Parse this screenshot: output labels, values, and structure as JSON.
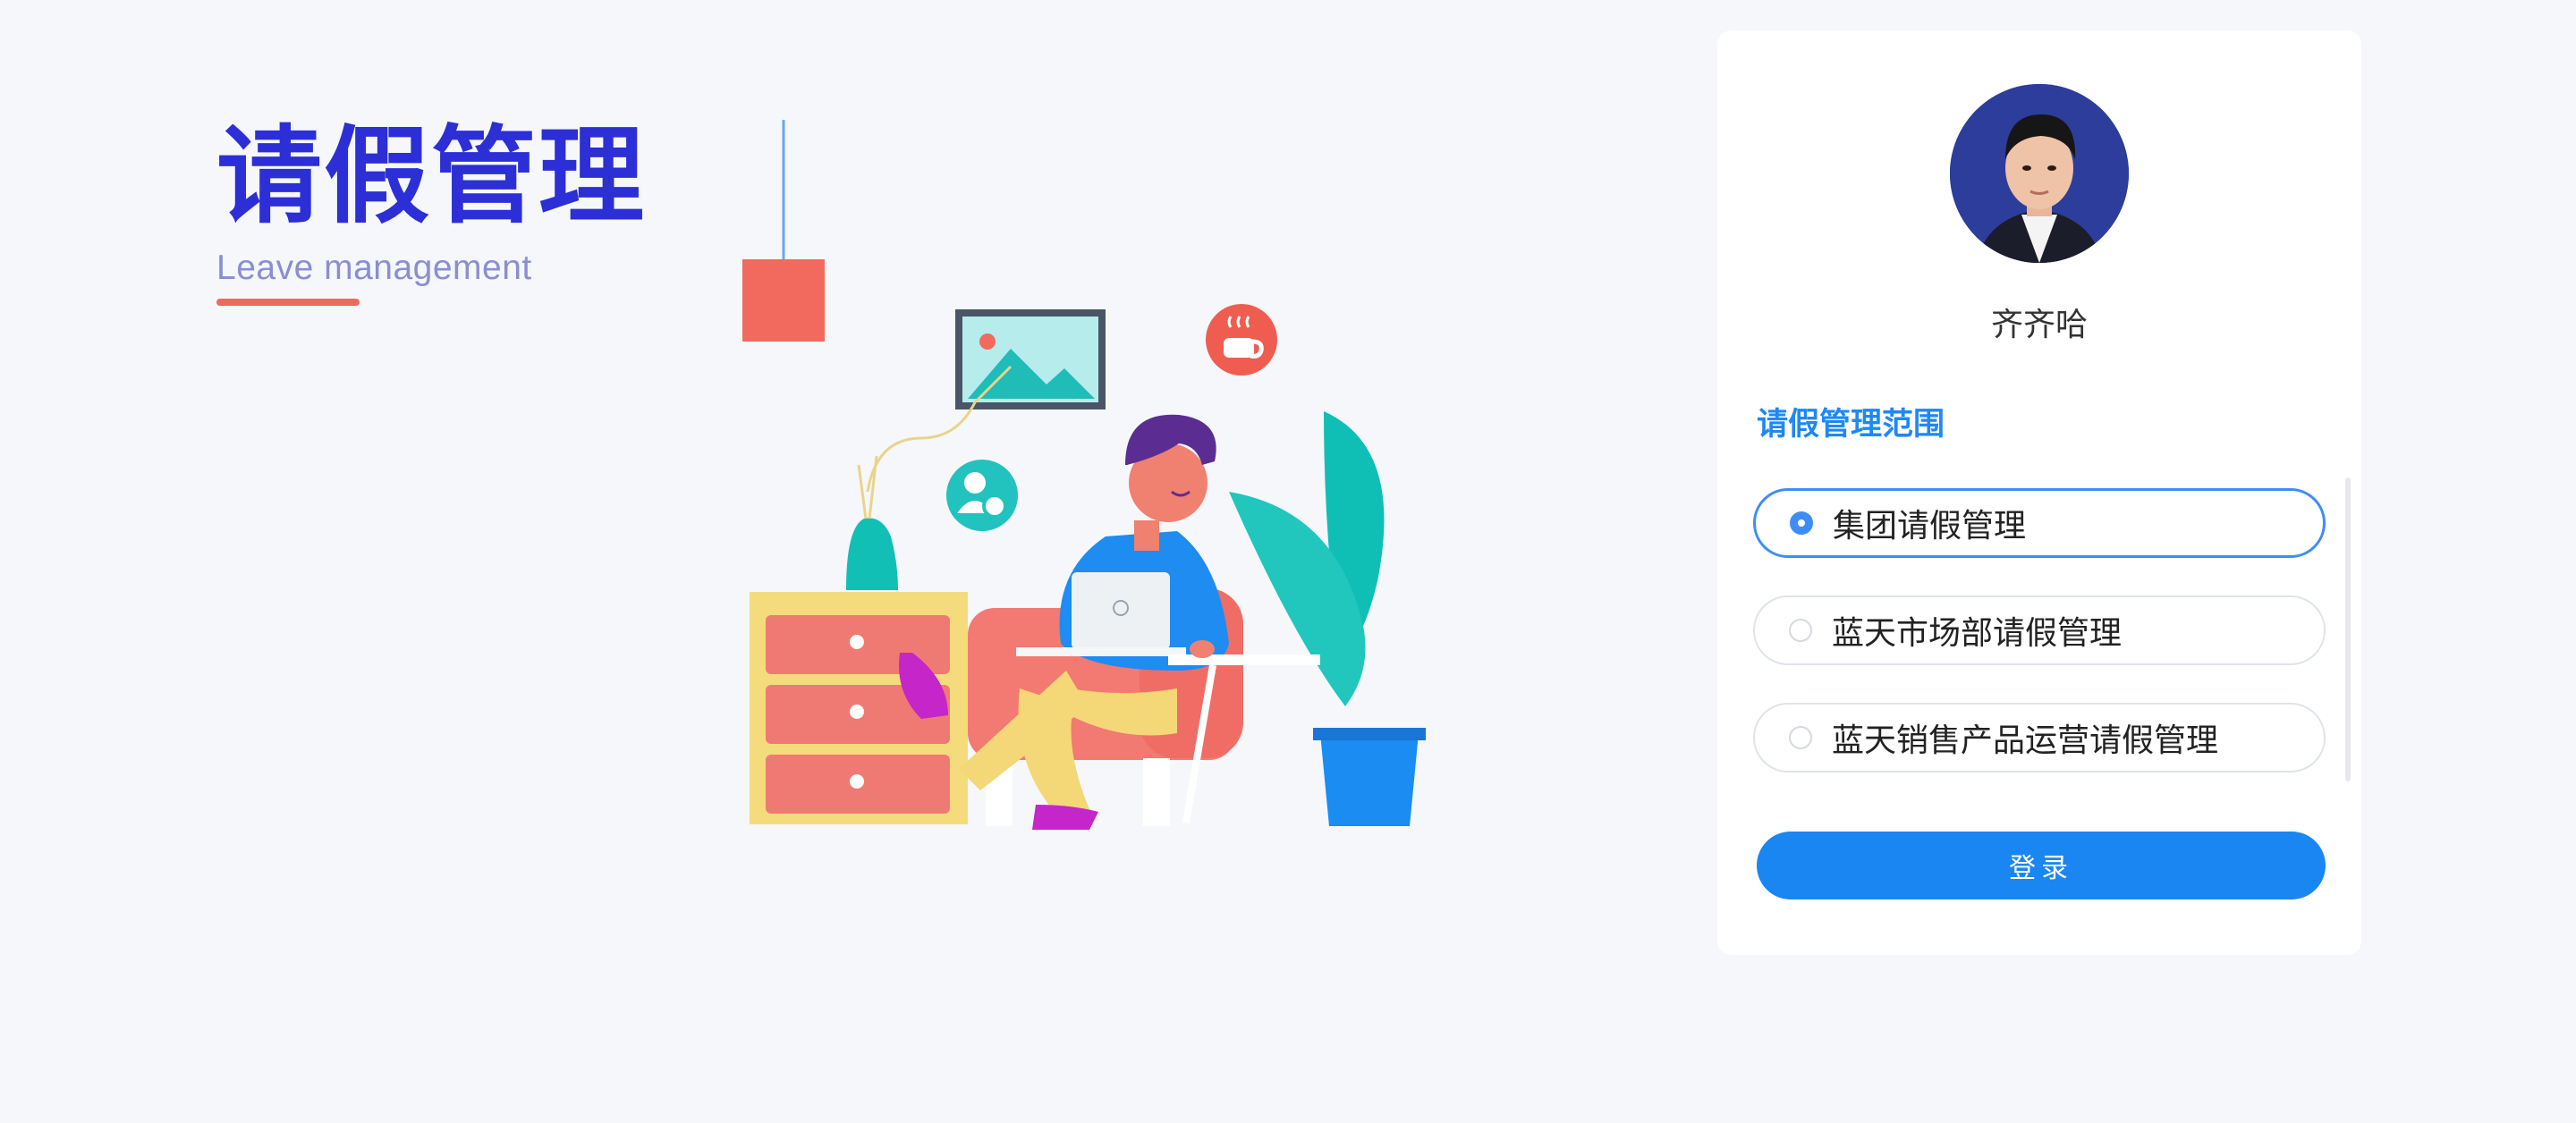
{
  "brand": {
    "title": "请假管理",
    "subtitle": "Leave management"
  },
  "user": {
    "name": "齐齐哈"
  },
  "scope": {
    "title": "请假管理范围",
    "options": [
      {
        "label": "集团请假管理",
        "selected": true
      },
      {
        "label": "蓝天市场部请假管理",
        "selected": false
      },
      {
        "label": "蓝天销售产品运营请假管理",
        "selected": false
      }
    ]
  },
  "actions": {
    "login_label": "登录"
  },
  "colors": {
    "brand": "#2c2fd6",
    "accent": "#1a86f2",
    "underline": "#ef6a5e",
    "background": "#f5f7fb"
  }
}
